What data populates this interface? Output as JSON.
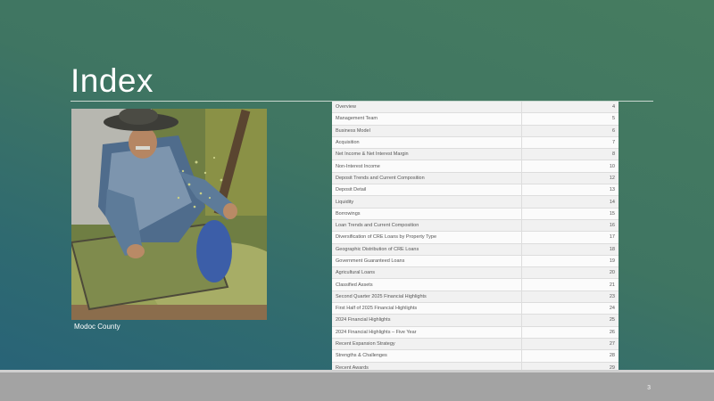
{
  "slide": {
    "title": "Index",
    "caption": "Modoc County",
    "page_number": "3"
  },
  "photo": {
    "description_icon": "farmer-sorting-grain-photo"
  },
  "index": [
    {
      "label": "Overview",
      "page": "4"
    },
    {
      "label": "Management Team",
      "page": "5"
    },
    {
      "label": "Business Model",
      "page": "6"
    },
    {
      "label": "Acquisition",
      "page": "7"
    },
    {
      "label": "Net Income & Net Interest Margin",
      "page": "8"
    },
    {
      "label": "Non-Interest Income",
      "page": "10"
    },
    {
      "label": "Deposit Trends and Current Composition",
      "page": "12"
    },
    {
      "label": "Deposit Detail",
      "page": "13"
    },
    {
      "label": "Liquidity",
      "page": "14"
    },
    {
      "label": "Borrowings",
      "page": "15"
    },
    {
      "label": "Loan Trends and Current Composition",
      "page": "16"
    },
    {
      "label": "Diversification of CRE Loans by Property Type",
      "page": "17"
    },
    {
      "label": "Geographic Distribution of CRE Loans",
      "page": "18"
    },
    {
      "label": "Government Guaranteed Loans",
      "page": "19"
    },
    {
      "label": "Agricultural Loans",
      "page": "20"
    },
    {
      "label": "Classified Assets",
      "page": "21"
    },
    {
      "label": "Second Quarter 2025 Financial Highlights",
      "page": "23"
    },
    {
      "label": "First Half of 2025 Financial Highlights",
      "page": "24"
    },
    {
      "label": "2024 Financial Highlights",
      "page": "25"
    },
    {
      "label": "2024 Financial Highlights – Five Year",
      "page": "26"
    },
    {
      "label": "Recent Expansion Strategy",
      "page": "27"
    },
    {
      "label": "Strengths & Challenges",
      "page": "28"
    },
    {
      "label": "Recent Awards",
      "page": "29"
    }
  ]
}
